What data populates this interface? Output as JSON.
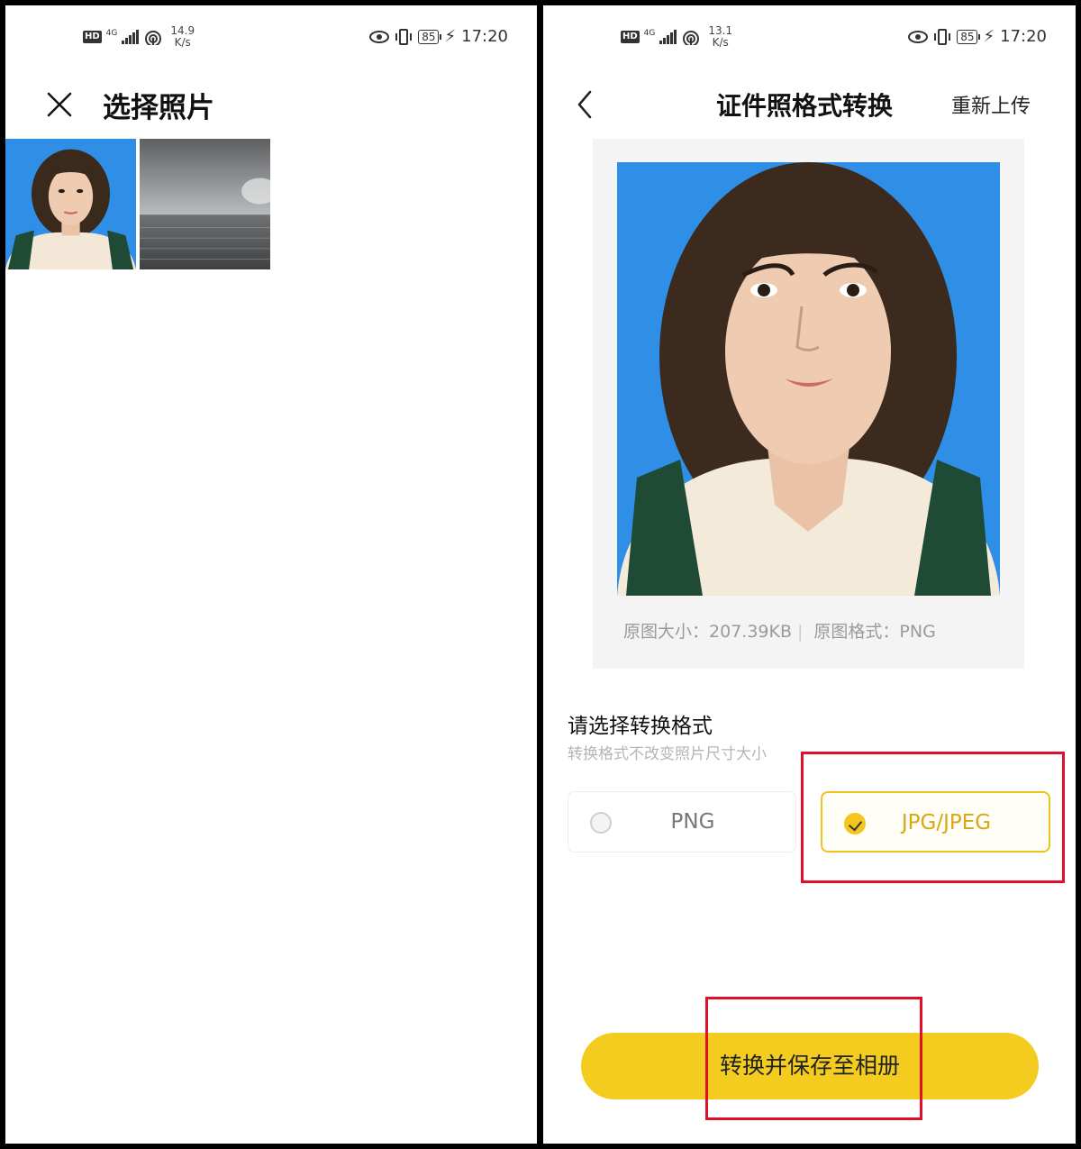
{
  "left": {
    "status": {
      "net": "4G",
      "speed_value": "14.9",
      "speed_unit": "K/s",
      "battery": "85",
      "time": "17:20"
    },
    "title": "选择照片",
    "photos": [
      {
        "name": "id-photo-thumbnail"
      },
      {
        "name": "sea-photo-thumbnail"
      }
    ]
  },
  "right": {
    "status": {
      "net": "4G",
      "speed_value": "13.1",
      "speed_unit": "K/s",
      "battery": "85",
      "time": "17:20"
    },
    "title": "证件照格式转换",
    "reupload": "重新上传",
    "info": {
      "size_label": "原图大小：",
      "size_value": "207.39KB",
      "format_label": "原图格式：",
      "format_value": "PNG"
    },
    "section_title": "请选择转换格式",
    "section_sub": "转换格式不改变照片尺寸大小",
    "options": [
      {
        "label": "PNG",
        "selected": false
      },
      {
        "label": "JPG/JPEG",
        "selected": true
      }
    ],
    "cta": "转换并保存至相册"
  },
  "colors": {
    "accent": "#f4cc1f",
    "photo_bg": "#2f8fe7",
    "highlight": "#e0102b"
  }
}
